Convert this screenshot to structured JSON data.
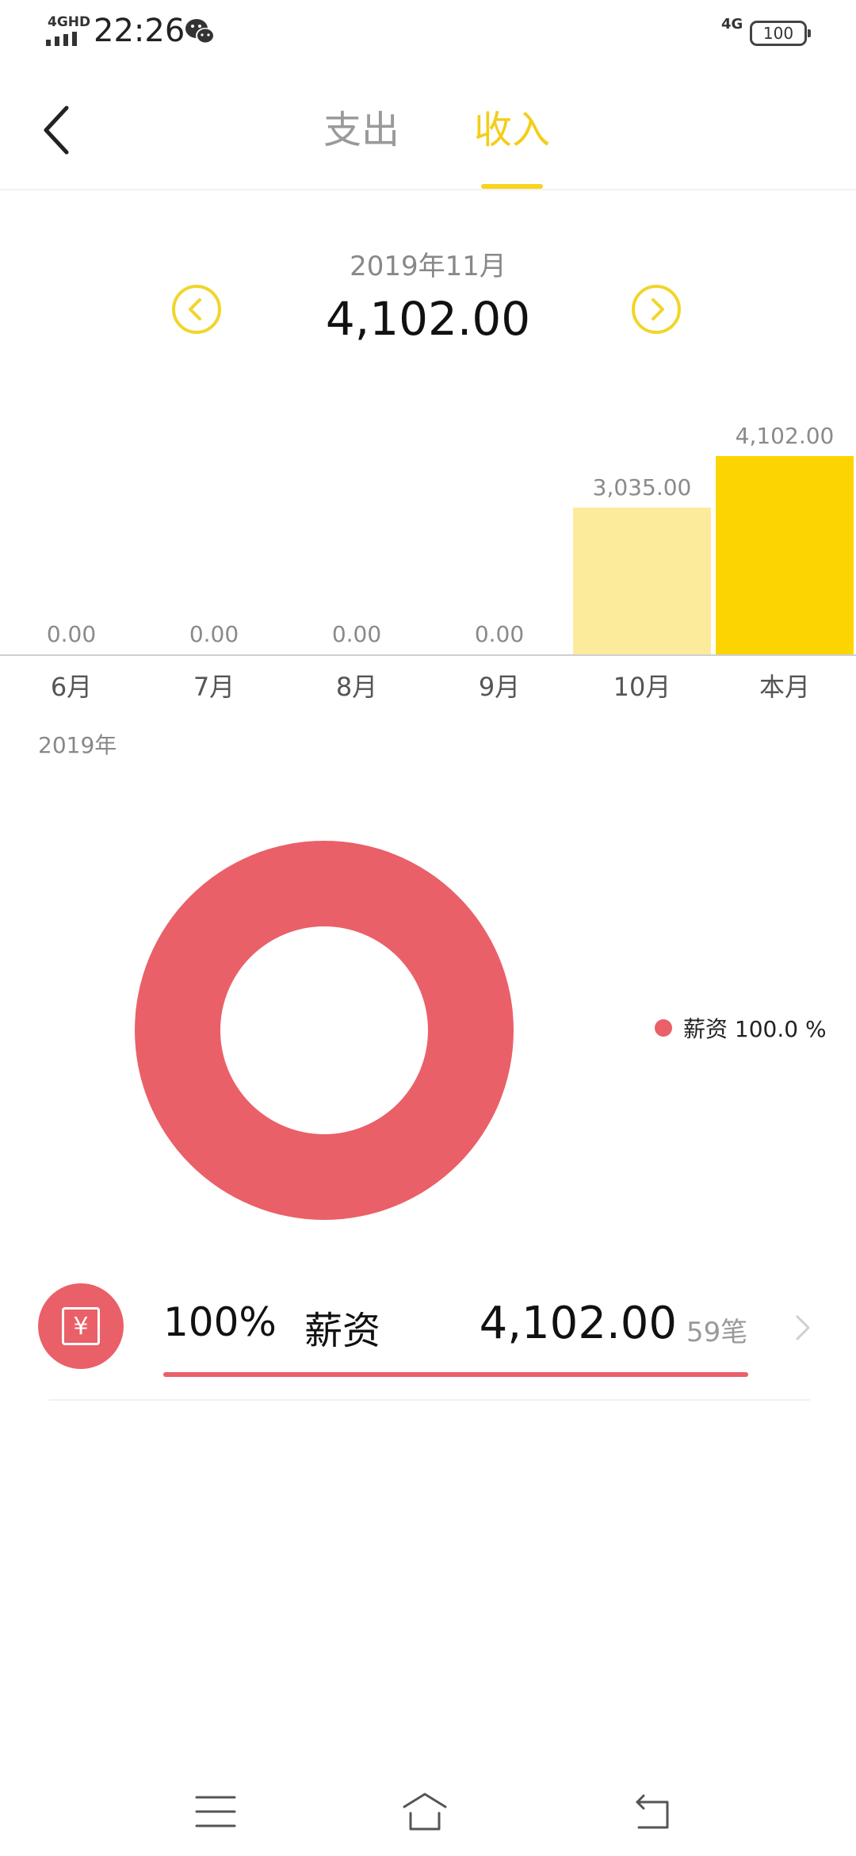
{
  "status_bar": {
    "network": "4GHD",
    "time": "22:26",
    "network_right": "4G",
    "battery": "100"
  },
  "header": {
    "tabs": [
      {
        "label": "支出",
        "active": false
      },
      {
        "label": "收入",
        "active": true
      }
    ],
    "accent_color": "#f8d41c"
  },
  "summary": {
    "month_label": "2019年11月",
    "total": "4,102.00"
  },
  "chart_data": {
    "type": "bar",
    "categories": [
      "6月",
      "7月",
      "8月",
      "9月",
      "10月",
      "本月"
    ],
    "values": [
      0.0,
      0.0,
      0.0,
      0.0,
      3035.0,
      4102.0
    ],
    "value_labels": [
      "0.00",
      "0.00",
      "0.00",
      "0.00",
      "3,035.00",
      "4,102.00"
    ],
    "colors": [
      "#fdea9b",
      "#fdea9b",
      "#fdea9b",
      "#fdea9b",
      "#fdeb9c",
      "#fcd402"
    ],
    "ylim": [
      0,
      4102
    ]
  },
  "year_label": "2019年",
  "donut": {
    "slices": [
      {
        "name": "薪资",
        "percent": 100.0,
        "color": "#ea6068"
      }
    ],
    "legend_text": "薪资 100.0 %"
  },
  "category": {
    "icon": "yuan-icon",
    "percent": "100%",
    "name": "薪资",
    "amount": "4,102.00",
    "count": "59笔",
    "progress": 1.0,
    "color": "#ea6068"
  },
  "bottom_nav": {
    "items": [
      "menu-icon",
      "home-icon",
      "back-icon"
    ]
  }
}
